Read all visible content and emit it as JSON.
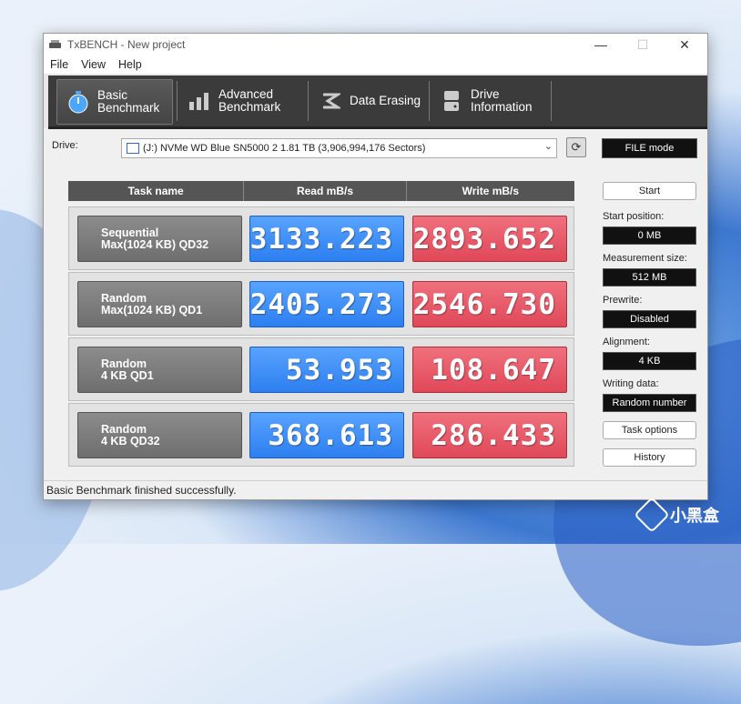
{
  "window": {
    "title": "TxBENCH - New project"
  },
  "menu": [
    "File",
    "View",
    "Help"
  ],
  "toolbar": [
    {
      "line1": "Basic",
      "line2": "Benchmark",
      "icon": "stopwatch-icon",
      "active": true
    },
    {
      "line1": "Advanced",
      "line2": "Benchmark",
      "icon": "bar-chart-icon",
      "active": false
    },
    {
      "line1": "Data Erasing",
      "line2": "",
      "icon": "eraser-icon",
      "active": false
    },
    {
      "line1": "Drive",
      "line2": "Information",
      "icon": "drive-info-icon",
      "active": false
    }
  ],
  "drive": {
    "label": "Drive:",
    "selected": "(J:) NVMe WD Blue SN5000 2  1.81 TB (3,906,994,176 Sectors)",
    "mode": "FILE mode"
  },
  "table": {
    "headers": [
      "Task name",
      "Read mB/s",
      "Write mB/s"
    ],
    "rows": [
      {
        "task1": "Sequential",
        "task2": "Max(1024 KB) QD32",
        "read": "3133.223",
        "write": "2893.652"
      },
      {
        "task1": "Random",
        "task2": "Max(1024 KB) QD1",
        "read": "2405.273",
        "write": "2546.730"
      },
      {
        "task1": "Random",
        "task2": "4 KB QD1",
        "read": "53.953",
        "write": "108.647"
      },
      {
        "task1": "Random",
        "task2": "4 KB QD32",
        "read": "368.613",
        "write": "286.433"
      }
    ]
  },
  "side": {
    "start": "Start",
    "start_position_label": "Start position:",
    "start_position": "0 MB",
    "measurement_size_label": "Measurement size:",
    "measurement_size": "512 MB",
    "prewrite_label": "Prewrite:",
    "prewrite": "Disabled",
    "alignment_label": "Alignment:",
    "alignment": "4 KB",
    "writing_data_label": "Writing data:",
    "writing_data": "Random number",
    "task_options": "Task options",
    "history": "History"
  },
  "status": "Basic Benchmark finished successfully.",
  "watermark": "小黑盒",
  "colors": {
    "read": "#2d7ff0",
    "write": "#e04858",
    "toolbar": "#3b3b3b"
  }
}
